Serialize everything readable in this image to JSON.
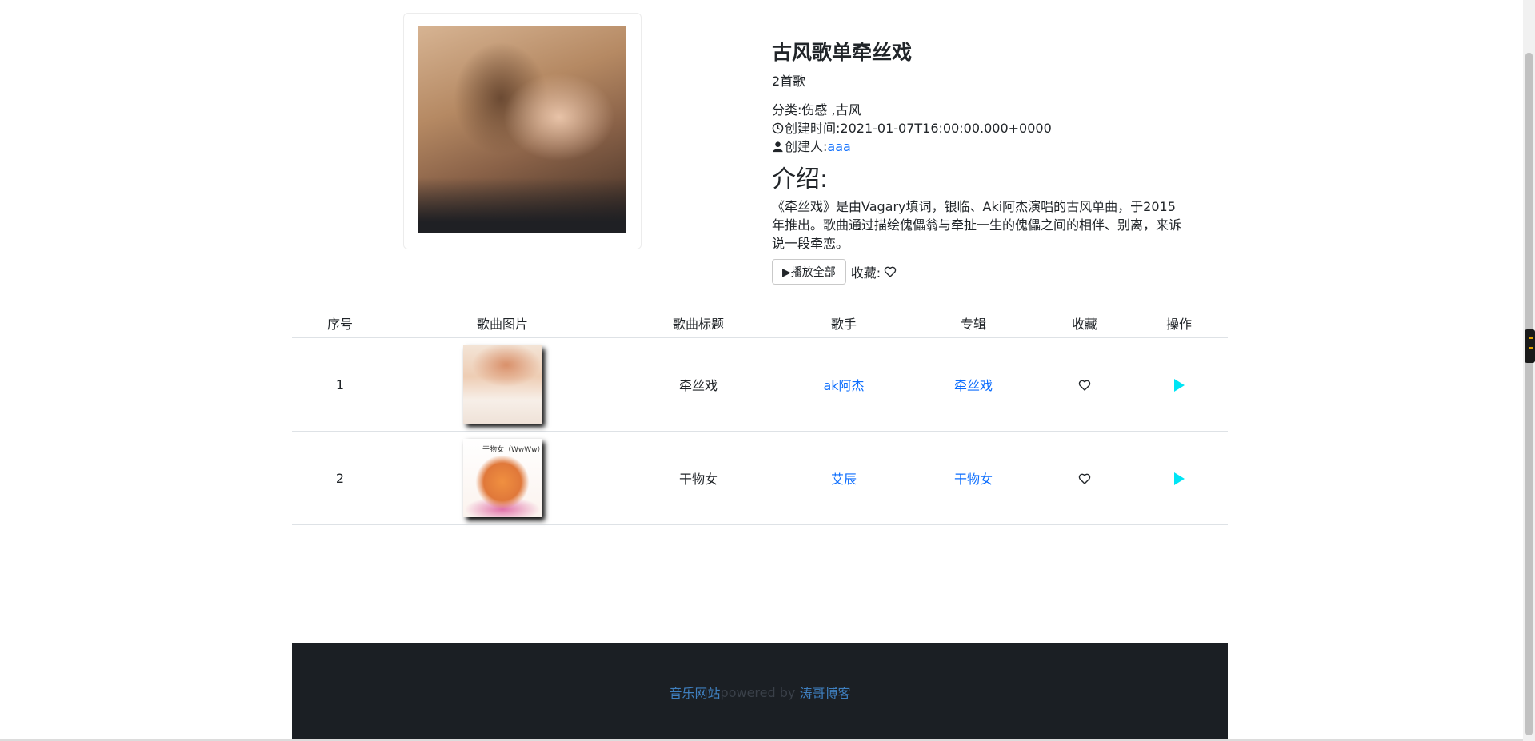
{
  "playlist": {
    "title": "古风歌单牵丝戏",
    "count": "2首歌",
    "category_label": "分类:",
    "category_value": "伤感 ,古风",
    "created_label": "创建时间:",
    "created_value": "2021-01-07T16:00:00.000+0000",
    "creator_label": "创建人:",
    "creator_value": "aaa",
    "intro_heading": "介绍:",
    "intro_text": "《牵丝戏》是由Vagary填词，银临、Aki阿杰演唱的古风单曲，于2015年推出。歌曲通过描绘傀儡翁与牵扯一生的傀儡之间的相伴、别离，来诉说一段牵恋。",
    "play_all_label": "▶播放全部",
    "favorite_label": "收藏:"
  },
  "table": {
    "headers": [
      "序号",
      "歌曲图片",
      "歌曲标题",
      "歌手",
      "专辑",
      "收藏",
      "操作"
    ],
    "rows": [
      {
        "index": "1",
        "title": "牵丝戏",
        "singer": "ak阿杰",
        "album": "牵丝戏"
      },
      {
        "index": "2",
        "title": "干物女",
        "singer": "艾辰",
        "album": "干物女",
        "thumb_text": "干物女（WwWw）"
      }
    ]
  },
  "footer": {
    "site_link": "音乐网站",
    "powered_text": "powered by",
    "blog_link": "涛哥博客"
  },
  "colors": {
    "link": "#0d6efd",
    "play_icon": "#00e5f5",
    "footer_bg": "#1b1f24"
  },
  "icons": [
    "clock-icon",
    "user-icon",
    "heart-outline-icon",
    "play-icon"
  ]
}
